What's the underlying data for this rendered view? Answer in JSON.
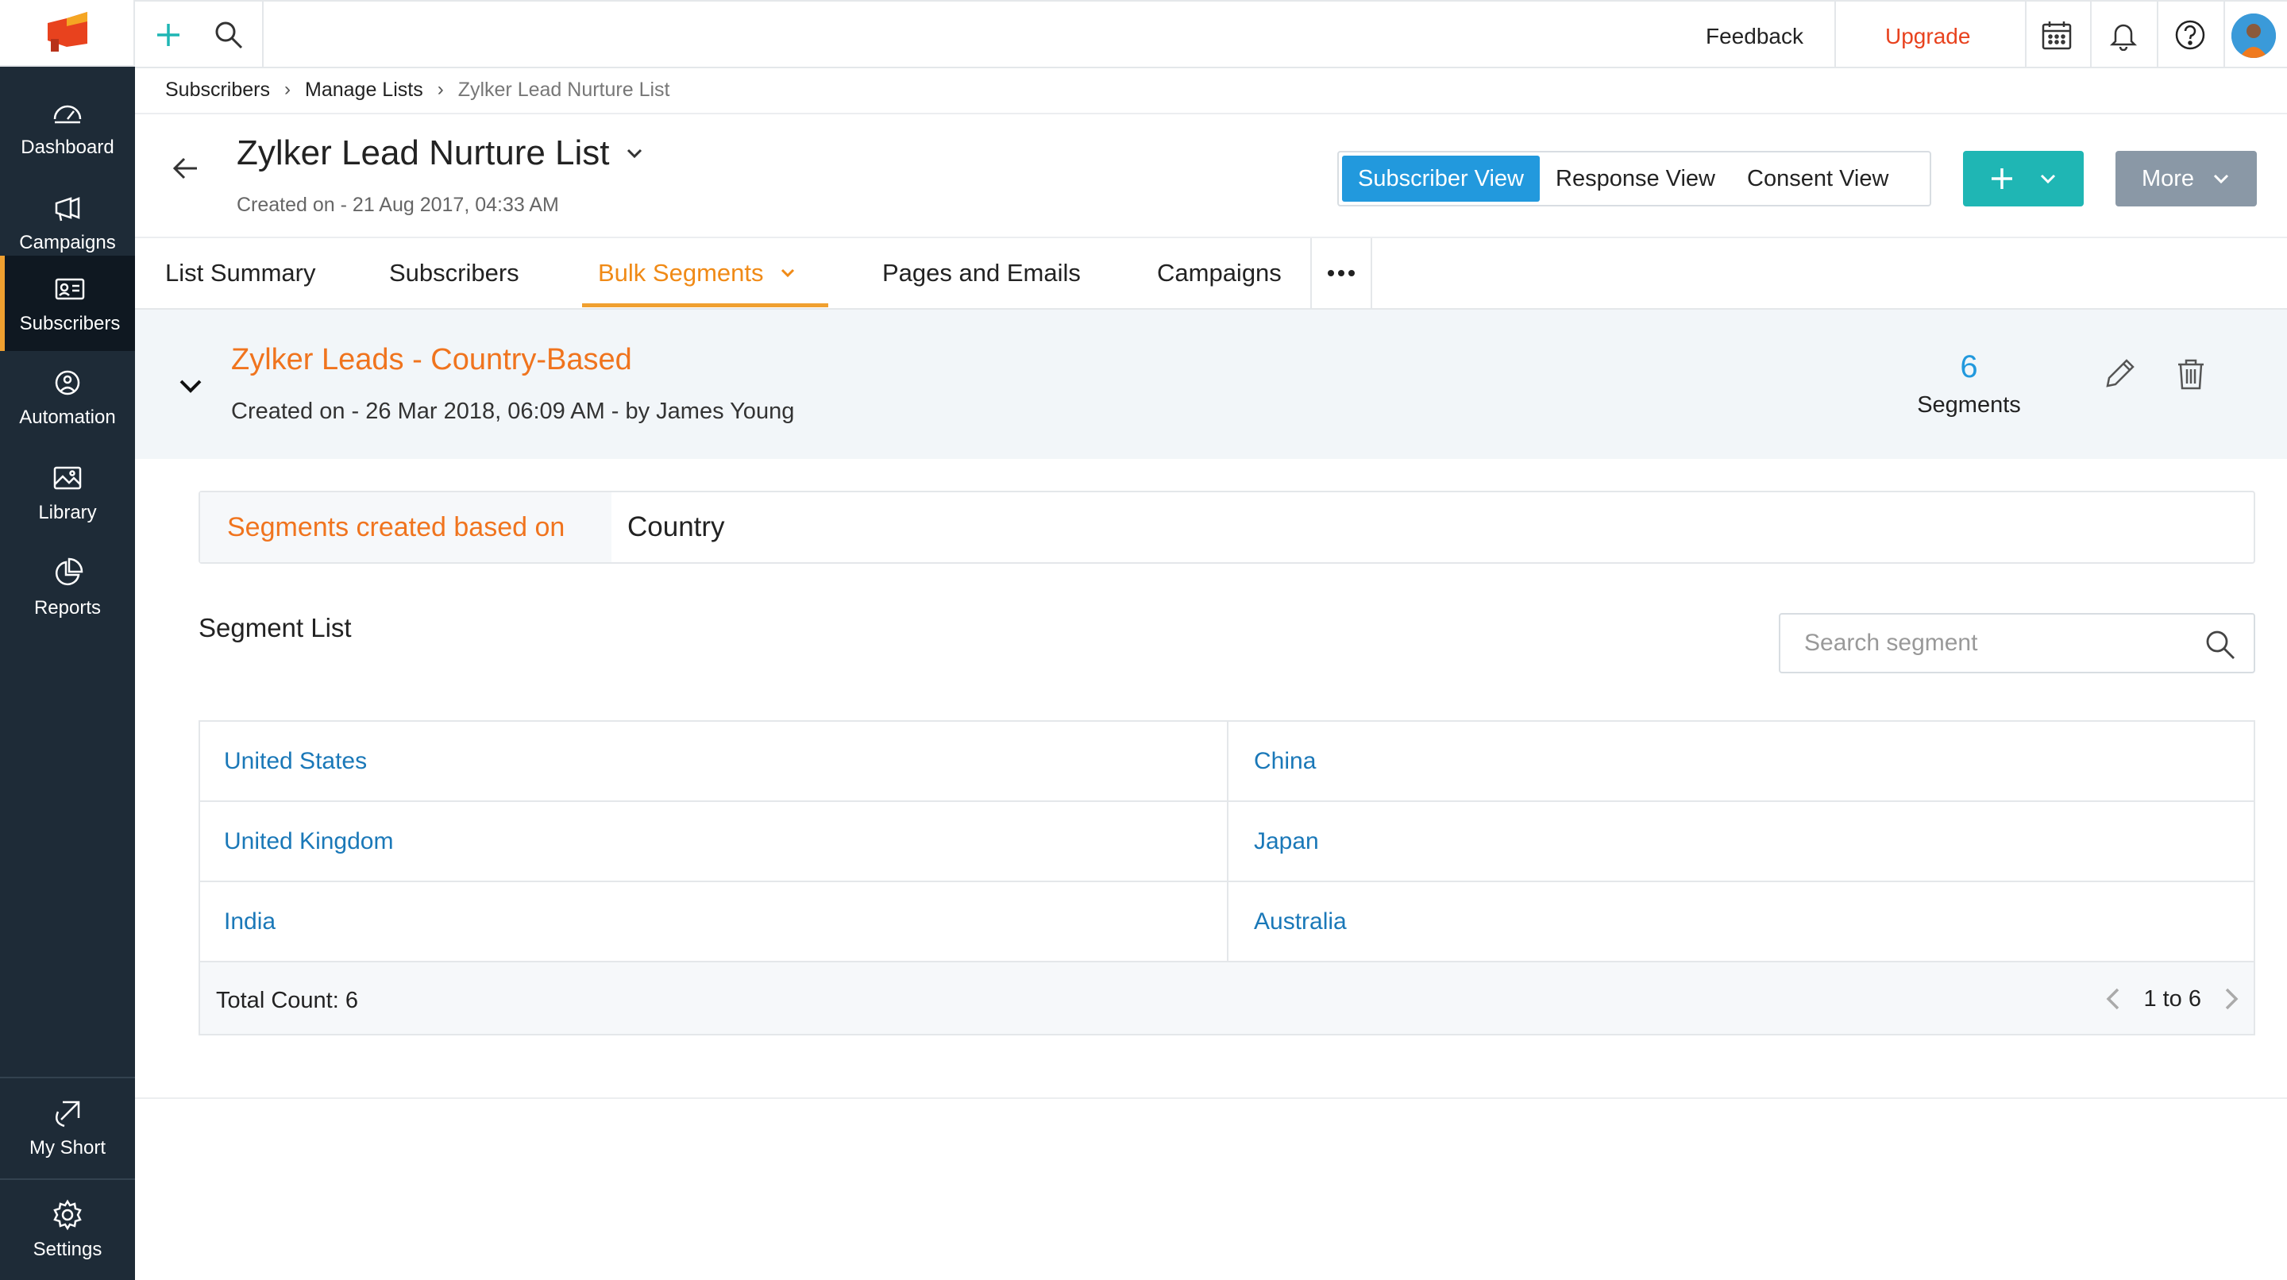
{
  "sidebar": {
    "items": [
      {
        "label": "Dashboard",
        "icon": "dashboard-icon"
      },
      {
        "label": "Campaigns",
        "icon": "megaphone-icon"
      },
      {
        "label": "Subscribers",
        "icon": "contact-card-icon"
      },
      {
        "label": "Automation",
        "icon": "automation-icon"
      },
      {
        "label": "Library",
        "icon": "image-icon"
      },
      {
        "label": "Reports",
        "icon": "pie-chart-icon"
      }
    ],
    "active": "Subscribers",
    "bottom_items": [
      {
        "label": "My Short",
        "icon": "shortcut-icon"
      },
      {
        "label": "Settings",
        "icon": "gear-icon"
      }
    ]
  },
  "topbar": {
    "feedback": "Feedback",
    "upgrade": "Upgrade"
  },
  "breadcrumb": {
    "items": [
      "Subscribers",
      "Manage Lists"
    ],
    "current": "Zylker Lead Nurture List"
  },
  "header": {
    "title": "Zylker Lead Nurture List",
    "created": "Created on - 21 Aug 2017, 04:33 AM",
    "views": [
      "Subscriber View",
      "Response View",
      "Consent View"
    ],
    "active_view": "Subscriber View",
    "more_label": "More"
  },
  "tabs": {
    "items": [
      "List Summary",
      "Subscribers",
      "Bulk Segments",
      "Pages and Emails",
      "Campaigns"
    ],
    "active": "Bulk Segments"
  },
  "segment_group": {
    "title": "Zylker Leads - Country-Based",
    "created": "Created on - 26 Mar 2018, 06:09 AM - by James Young",
    "count": "6",
    "count_label": "Segments"
  },
  "based_on": {
    "label": "Segments created based on",
    "value": "Country"
  },
  "segment_list": {
    "title": "Segment List",
    "search_placeholder": "Search segment",
    "rows": [
      [
        "United States",
        "China"
      ],
      [
        "United Kingdom",
        "Japan"
      ],
      [
        "India",
        "Australia"
      ]
    ],
    "total": "Total Count: 6",
    "pager": "1 to 6"
  },
  "colors": {
    "accent_orange": "#f0741e",
    "link_blue": "#1a78b8",
    "active_view_blue": "#2299dd",
    "add_teal": "#1fb6b4",
    "sidebar_bg": "#1e2b37",
    "upgrade_red": "#e8421e"
  }
}
